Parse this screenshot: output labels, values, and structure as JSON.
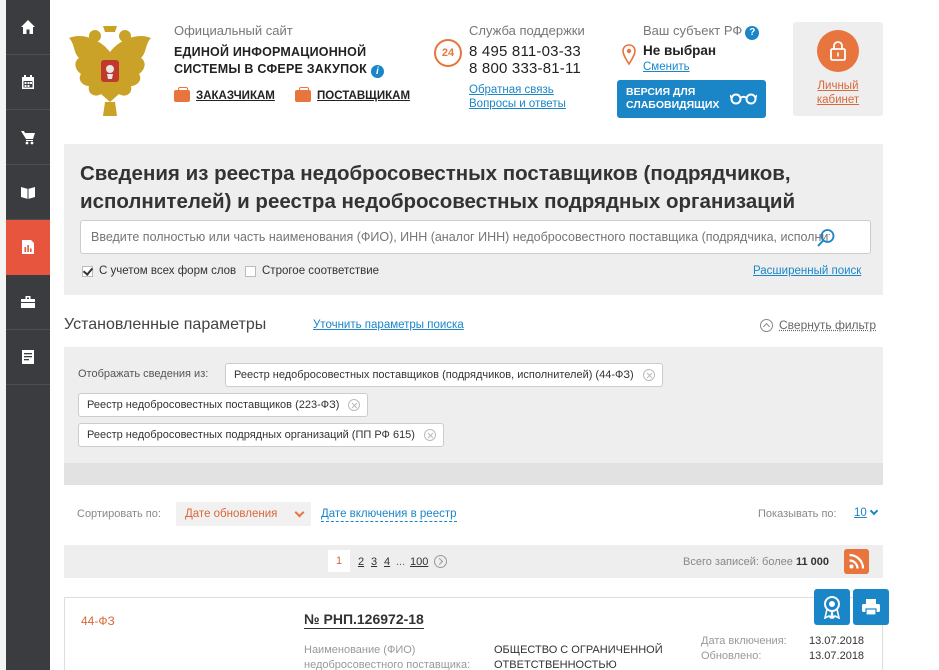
{
  "sidebar": {
    "items": [
      {
        "icon": "home-icon"
      },
      {
        "icon": "calendar-icon"
      },
      {
        "icon": "cart-icon"
      },
      {
        "icon": "book-icon"
      },
      {
        "icon": "report-icon",
        "active": true
      },
      {
        "icon": "briefcase-icon"
      },
      {
        "icon": "document-icon"
      }
    ]
  },
  "header": {
    "site_caption": "Официальный сайт",
    "site_name_line1": "ЕДИНОЙ ИНФОРМАЦИОННОЙ",
    "site_name_line2": "СИСТЕМЫ В СФЕРЕ ЗАКУПОК",
    "customers_link": "ЗАКАЗЧИКАМ",
    "suppliers_link": "ПОСТАВЩИКАМ",
    "support_caption": "Служба поддержки",
    "support_badge": "24",
    "phone1": "8 495 811-03-33",
    "phone2": "8 800 333-81-11",
    "feedback_link": "Обратная связь",
    "faq_link": "Вопросы и ответы",
    "region_caption": "Ваш субъект РФ",
    "region_value": "Не выбран",
    "region_change": "Сменить",
    "vision_line1": "ВЕРСИЯ ДЛЯ",
    "vision_line2": "СЛАБОВИДЯЩИХ",
    "cabinet_line1": "Личный",
    "cabinet_line2": "кабинет"
  },
  "search": {
    "title": "Сведения из реестра недобросовестных поставщиков (подрядчиков, исполнителей) и реестра недобросовестных подрядных организаций",
    "placeholder": "Введите полностью или часть наименования (ФИО), ИНН (аналог ИНН) недобросовестного поставщика (подрядчика, исполнителя)",
    "option_all_forms": "С учетом всех форм слов",
    "option_all_forms_checked": true,
    "option_strict": "Строгое соответствие",
    "option_strict_checked": false,
    "advanced_link": "Расширенный поиск"
  },
  "params": {
    "title": "Установленные параметры",
    "refine_link": "Уточнить параметры поиска",
    "collapse_link": "Свернуть фильтр",
    "show_from_label": "Отображать сведения из:",
    "tags": [
      "Реестр недобросовестных поставщиков (подрядчиков, исполнителей) (44-ФЗ)",
      "Реестр недобросовестных поставщиков (223-ФЗ)",
      "Реестр недобросовестных подрядных организаций (ПП РФ 615)"
    ]
  },
  "sort": {
    "label": "Сортировать по:",
    "selected": "Дате обновления",
    "alt": "Дате включения в реестр",
    "per_page_label": "Показывать по:",
    "per_page_value": "10"
  },
  "pager": {
    "current": "1",
    "pages": [
      "2",
      "3",
      "4"
    ],
    "dots": "...",
    "last": "100",
    "total_label": "Всего записей: более",
    "total_value": "11 000"
  },
  "result": {
    "law": "44-ФЗ",
    "number": "№ РНП.126972-18",
    "name_label_line1": "Наименование (ФИО)",
    "name_label_line2": "недобросовестного поставщика:",
    "name_value_line1": "ОБЩЕСТВО С ОГРАНИЧЕННОЙ",
    "name_value_line2": "ОТВЕТСТВЕННОСТЬЮ",
    "included_label": "Дата включения:",
    "included_value": "13.07.2018",
    "updated_label": "Обновлено:",
    "updated_value": "13.07.2018"
  },
  "colors": {
    "accent": "#e8743e",
    "link": "#1a86c8",
    "sidebar": "#3a3c3f"
  }
}
